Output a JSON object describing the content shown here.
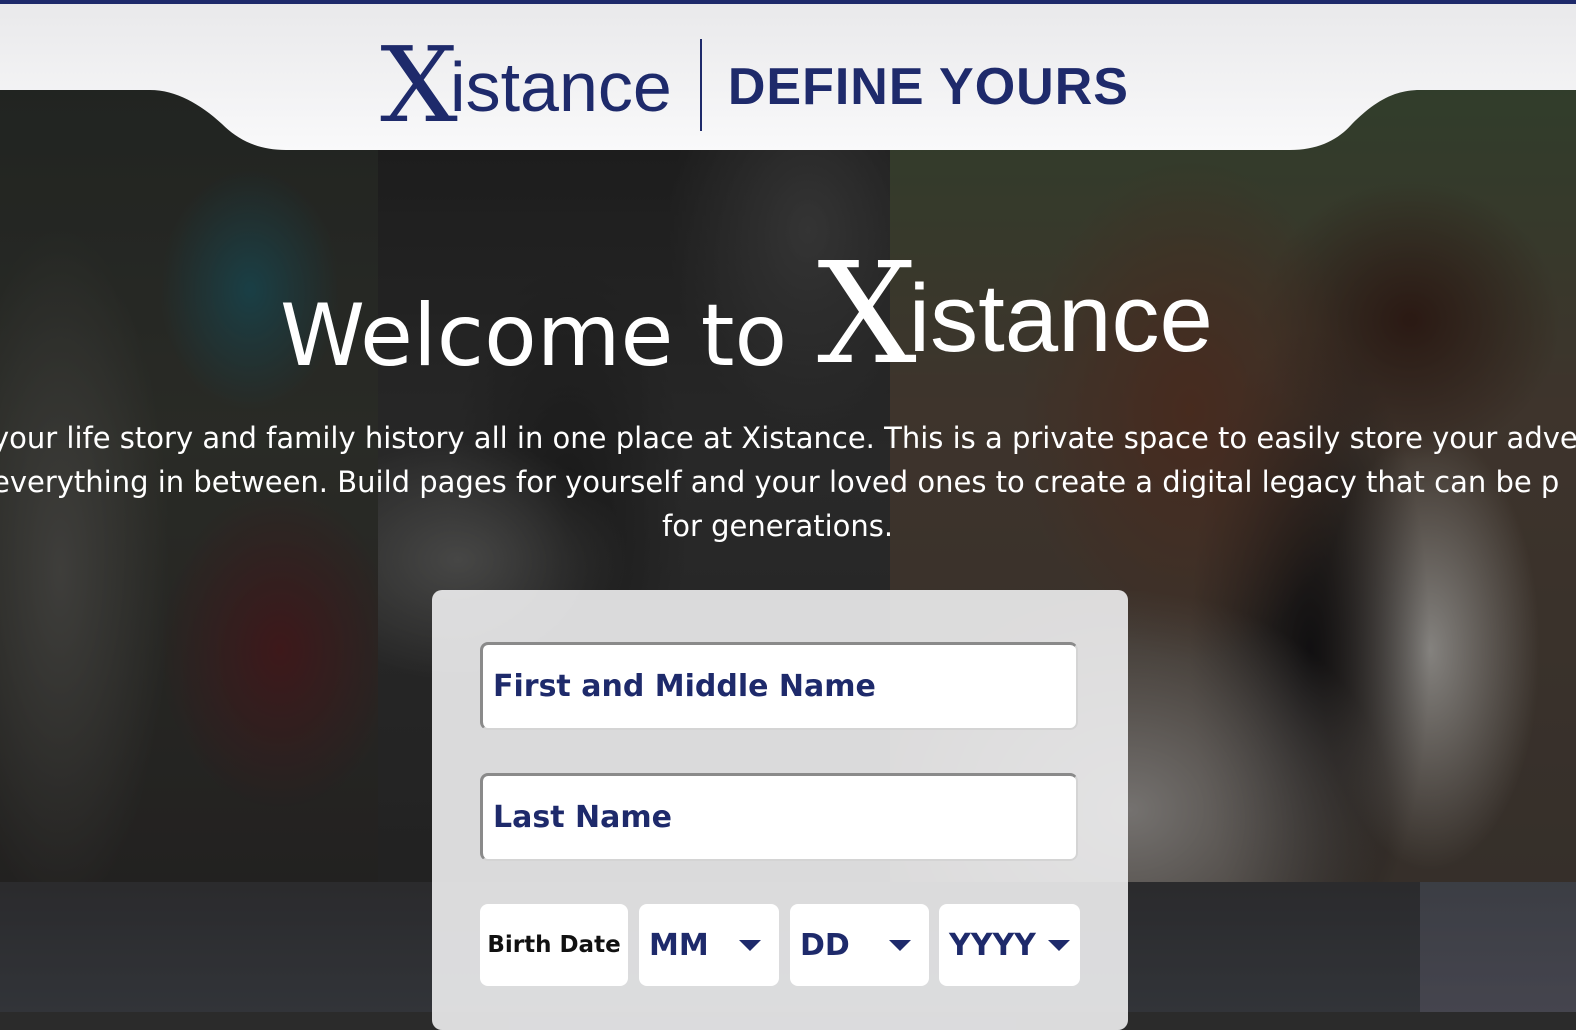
{
  "header": {
    "logo_x": "X",
    "logo_word": "istance",
    "tagline": "DEFINE YOURS"
  },
  "hero": {
    "welcome": "Welcome to",
    "brand_x": "X",
    "brand_word": "istance",
    "intro_line1": "your life story and family history all in one place at Xistance. This is a private space to easily store your adve",
    "intro_line2": "everything in between. Build pages for yourself and your loved ones to create a digital legacy that can be p",
    "intro_line3": "for generations."
  },
  "form": {
    "first_name_placeholder": "First and Middle Name",
    "last_name_placeholder": "Last Name",
    "birth_date_label": "Birth Date",
    "month_value": "MM",
    "day_value": "DD",
    "year_value": "YYYY"
  },
  "colors": {
    "brand_navy": "#1e2a6b",
    "header_bg": "#f0f0f2",
    "card_bg": "#eeeef0"
  }
}
